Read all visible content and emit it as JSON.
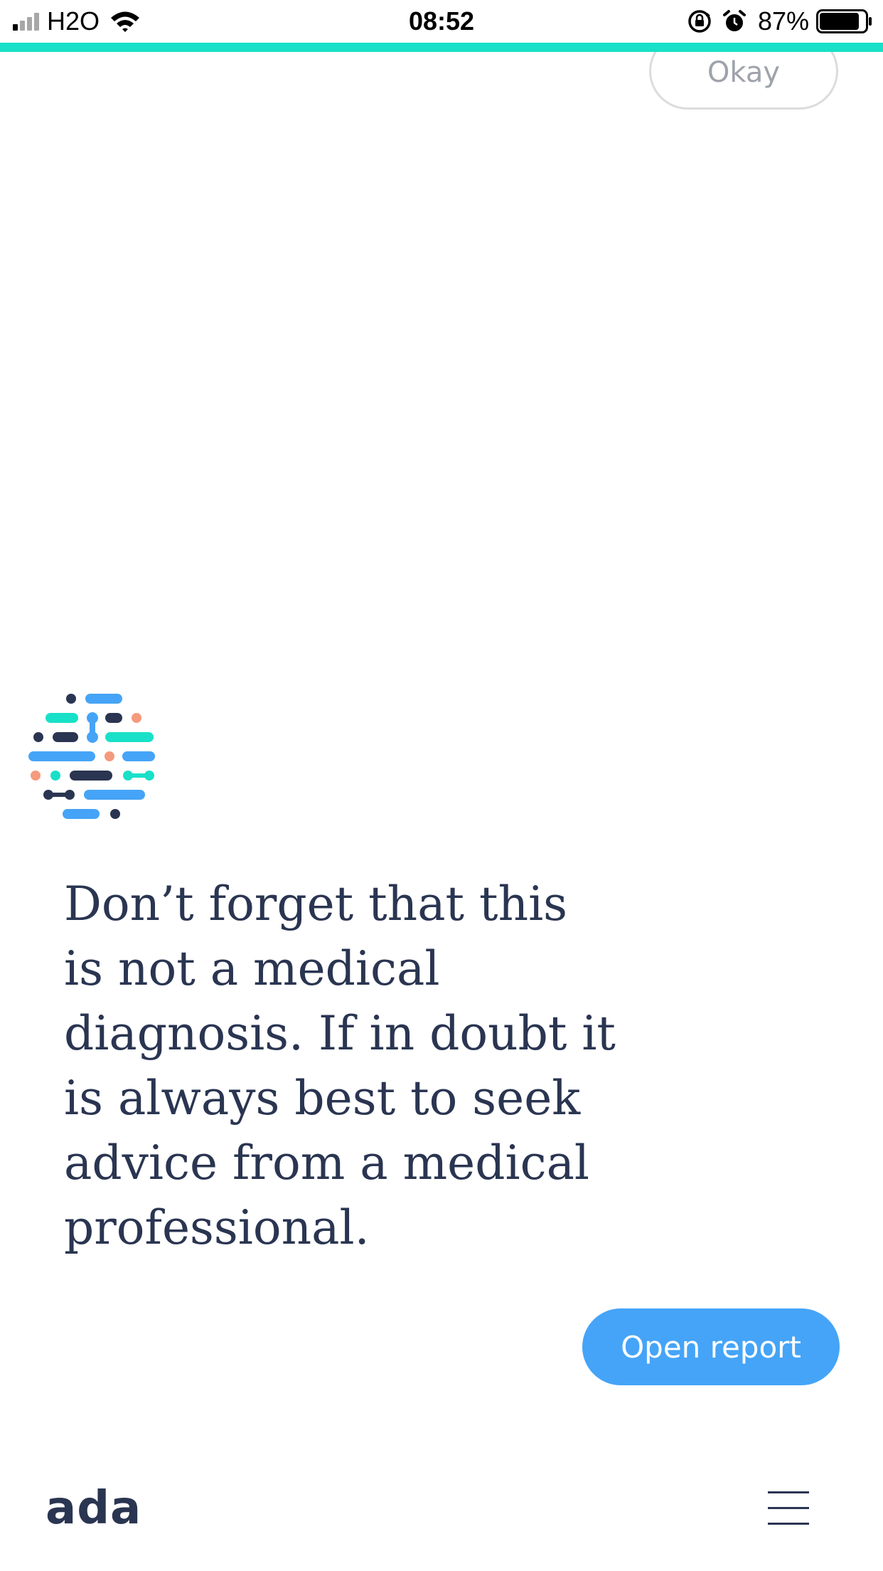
{
  "status_bar": {
    "carrier": "H2O",
    "time": "08:52",
    "battery_percent": "87%",
    "battery_level": 0.87,
    "signal_bars_active": 1,
    "icons": [
      "signal-icon",
      "wifi-icon",
      "rotation-lock-icon",
      "alarm-icon",
      "battery-icon"
    ]
  },
  "colors": {
    "accent": "#19e0c8",
    "primary_button": "#45a4f7",
    "text": "#2a3551",
    "logo_navy": "#2a3551",
    "logo_blue": "#45a4f7",
    "logo_teal": "#19e0c8",
    "logo_salmon": "#f59a7e"
  },
  "okay_button": {
    "label": "Okay"
  },
  "chat": {
    "avatar_icon": "ada-logo-mark-icon",
    "message": "Don’t forget that this is not a medical diagnosis. If in doubt it is always best to seek advice from a medical professional."
  },
  "actions": {
    "open_report_label": "Open report"
  },
  "footer": {
    "logo_text": "ada",
    "menu_icon": "hamburger-menu-icon"
  }
}
